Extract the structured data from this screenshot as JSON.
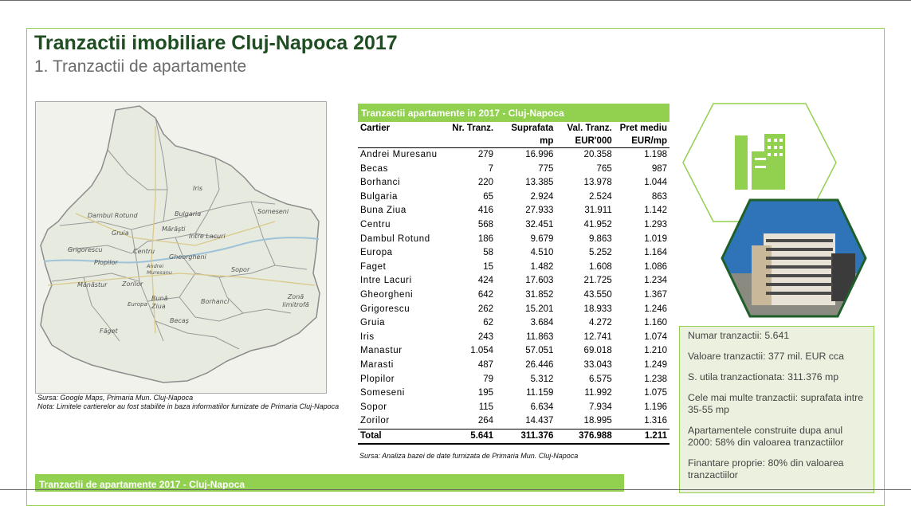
{
  "header": {
    "title": "Tranzactii imobiliare Cluj-Napoca 2017",
    "subtitle": "1. Tranzactii de apartamente"
  },
  "map": {
    "labels": [
      "Iris",
      "Dambul Rotund",
      "Bulgaria",
      "Someseni",
      "Gruia",
      "Mărăşti",
      "Intre Lacuri",
      "Grigorescu",
      "Centru",
      "Plopilor",
      "Gheorgheni",
      "Andrei Muresanu",
      "Sopor",
      "Mănăstur",
      "Zorilor",
      "Zonă limitrofă",
      "Europa",
      "Bună Ziua",
      "Borhanci",
      "Becaş",
      "Făget"
    ],
    "source_line1": "Sursa: Google Maps, Primaria Mun. Cluj-Napoca",
    "source_line2": "Nota: Limitele cartierelor au fost stabilite in baza informatiilor furnizate de Primaria Cluj-Napoca"
  },
  "table": {
    "title": "Tranzactii apartamente in 2017 - Cluj-Napoca",
    "headers": [
      "Cartier",
      "Nr. Tranz.",
      "Suprafata mp",
      "Val. Tranz. EUR'000",
      "Pret mediu EUR/mp"
    ],
    "rows": [
      [
        "Andrei Muresanu",
        "279",
        "16.996",
        "20.358",
        "1.198"
      ],
      [
        "Becas",
        "7",
        "775",
        "765",
        "987"
      ],
      [
        "Borhanci",
        "220",
        "13.385",
        "13.978",
        "1.044"
      ],
      [
        "Bulgaria",
        "65",
        "2.924",
        "2.524",
        "863"
      ],
      [
        "Buna Ziua",
        "416",
        "27.933",
        "31.911",
        "1.142"
      ],
      [
        "Centru",
        "568",
        "32.451",
        "41.952",
        "1.293"
      ],
      [
        "Dambul Rotund",
        "186",
        "9.679",
        "9.863",
        "1.019"
      ],
      [
        "Europa",
        "58",
        "4.510",
        "5.252",
        "1.164"
      ],
      [
        "Faget",
        "15",
        "1.482",
        "1.608",
        "1.086"
      ],
      [
        "Intre Lacuri",
        "424",
        "17.603",
        "21.725",
        "1.234"
      ],
      [
        "Gheorgheni",
        "642",
        "31.852",
        "43.550",
        "1.367"
      ],
      [
        "Grigorescu",
        "262",
        "15.201",
        "18.933",
        "1.246"
      ],
      [
        "Gruia",
        "62",
        "3.684",
        "4.272",
        "1.160"
      ],
      [
        "Iris",
        "243",
        "11.863",
        "12.741",
        "1.074"
      ],
      [
        "Manastur",
        "1.054",
        "57.051",
        "69.018",
        "1.210"
      ],
      [
        "Marasti",
        "487",
        "26.446",
        "33.043",
        "1.249"
      ],
      [
        "Plopilor",
        "79",
        "5.312",
        "6.575",
        "1.238"
      ],
      [
        "Someseni",
        "195",
        "11.159",
        "11.992",
        "1.075"
      ],
      [
        "Sopor",
        "115",
        "6.634",
        "7.934",
        "1.196"
      ],
      [
        "Zorilor",
        "264",
        "14.437",
        "18.995",
        "1.316"
      ]
    ],
    "total": [
      "Total",
      "5.641",
      "311.376",
      "376.988",
      "1.211"
    ],
    "source": "Sursa: Analiza bazei de date furnizata de Primaria Mun. Cluj-Napoca"
  },
  "stats": [
    "Numar tranzactii: 5.641",
    "Valoare tranzactii: 377 mil. EUR cca",
    "S. utila tranzactionata: 311.376 mp",
    "Cele mai multe tranzactii:    suprafata intre 35-55 mp",
    "Apartamentele construite dupa anul 2000: 58% din valoarea tranzactiilor",
    "Finantare proprie: 80% din valoarea tranzactiilor"
  ],
  "bottom_bar": "Tranzactii de apartamente 2017 - Cluj-Napoca",
  "colors": {
    "accent": "#92d050",
    "title": "#1f4e23",
    "stats_bg": "#ebf1de"
  },
  "icons": [
    "buildings-icon"
  ]
}
